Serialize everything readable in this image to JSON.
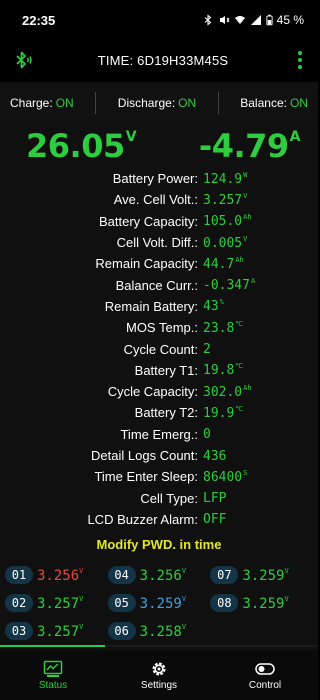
{
  "status_bar": {
    "time": "22:35",
    "battery_pct": "45 %"
  },
  "app_bar": {
    "title": "TIME: 6D19H33M45S"
  },
  "toggles": [
    {
      "label": "Charge:",
      "value": "ON"
    },
    {
      "label": "Discharge:",
      "value": "ON"
    },
    {
      "label": "Balance:",
      "value": "ON"
    }
  ],
  "readout": {
    "voltage": "26.05",
    "voltage_unit": "V",
    "current": "-4.79",
    "current_unit": "A"
  },
  "info": [
    {
      "label": "Battery Power:",
      "value": "124.9",
      "unit": "W"
    },
    {
      "label": "Ave. Cell Volt.:",
      "value": "3.257",
      "unit": "V"
    },
    {
      "label": "Battery Capacity:",
      "value": "105.0",
      "unit": "Ah"
    },
    {
      "label": "Cell Volt. Diff.:",
      "value": "0.005",
      "unit": "V"
    },
    {
      "label": "Remain Capacity:",
      "value": "44.7",
      "unit": "Ah"
    },
    {
      "label": "Balance Curr.:",
      "value": "-0.347",
      "unit": "A"
    },
    {
      "label": "Remain Battery:",
      "value": "43",
      "unit": "%"
    },
    {
      "label": "MOS Temp.:",
      "value": "23.8",
      "unit": "℃"
    },
    {
      "label": "Cycle Count:",
      "value": "2",
      "unit": ""
    },
    {
      "label": "Battery T1:",
      "value": "19.8",
      "unit": "℃"
    },
    {
      "label": "Cycle Capacity:",
      "value": "302.0",
      "unit": "Ah"
    },
    {
      "label": "Battery T2:",
      "value": "19.9",
      "unit": "℃"
    },
    {
      "label": "Time Emerg.:",
      "value": "0",
      "unit": ""
    },
    {
      "label": "Detail Logs Count:",
      "value": "436",
      "unit": ""
    },
    {
      "label": "Time Enter Sleep:",
      "value": "86400",
      "unit": "S"
    },
    {
      "label": "Cell Type:",
      "value": "LFP",
      "unit": ""
    },
    {
      "label": "LCD Buzzer Alarm:",
      "value": "OFF",
      "unit": ""
    }
  ],
  "modify_label": "Modify PWD. in time",
  "cells": [
    {
      "num": "01",
      "volt": "3.256",
      "unit": "V",
      "state": "max"
    },
    {
      "num": "04",
      "volt": "3.256",
      "unit": "V",
      "state": ""
    },
    {
      "num": "07",
      "volt": "3.259",
      "unit": "V",
      "state": ""
    },
    {
      "num": "02",
      "volt": "3.257",
      "unit": "V",
      "state": ""
    },
    {
      "num": "05",
      "volt": "3.259",
      "unit": "V",
      "state": "min"
    },
    {
      "num": "08",
      "volt": "3.259",
      "unit": "V",
      "state": ""
    },
    {
      "num": "03",
      "volt": "3.257",
      "unit": "V",
      "state": ""
    },
    {
      "num": "06",
      "volt": "3.258",
      "unit": "V",
      "state": ""
    }
  ],
  "progress_fraction": 0.33,
  "nav": [
    {
      "label": "Status",
      "icon": "status-chart-icon",
      "active": true
    },
    {
      "label": "Settings",
      "icon": "gear-icon",
      "active": false
    },
    {
      "label": "Control",
      "icon": "toggle-icon",
      "active": false
    }
  ],
  "colors": {
    "accent": "#2ecc40",
    "max_cell": "#e04a3f",
    "min_cell": "#3f9fe0",
    "modify": "#e3e62a"
  }
}
